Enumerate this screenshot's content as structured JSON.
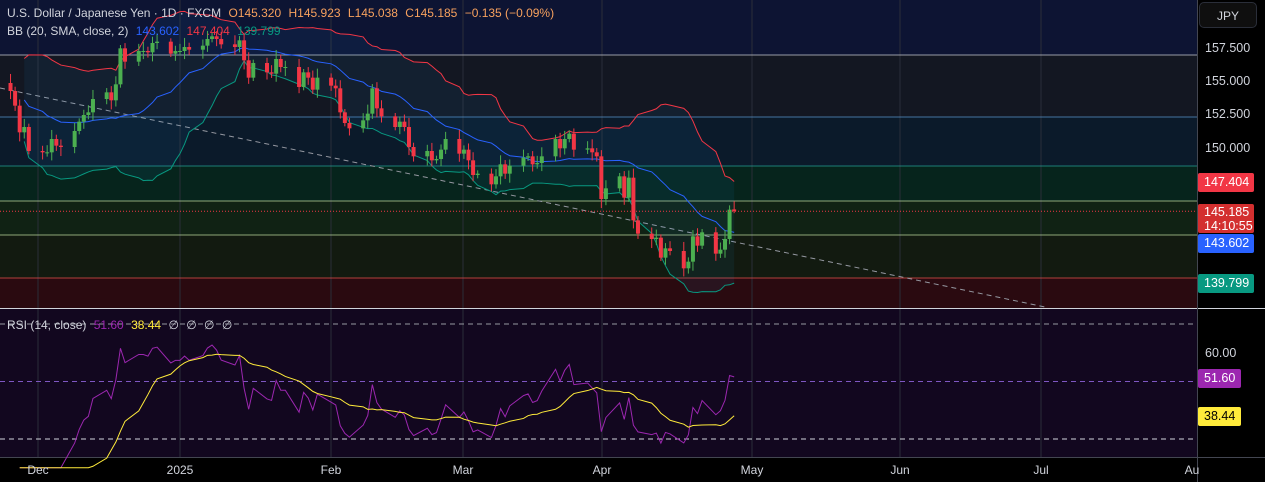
{
  "header": {
    "symbol": "U.S. Dollar / Japanese Yen · 1D · FXCM",
    "open": "O145.320",
    "high": "H145.923",
    "low": "L145.038",
    "close": "C145.185",
    "change": "−0.135 (−0.09%)"
  },
  "bb_legend": {
    "label": "BB (20, SMA, close, 2)",
    "basis": "143.602",
    "upper": "147.404",
    "lower": "139.799"
  },
  "rsi_legend": {
    "label": "RSI (14, close)",
    "rsi": "51.60",
    "ma": "38.44",
    "extra": [
      "∅",
      "∅",
      "∅",
      "∅"
    ]
  },
  "currency_button": "JPY",
  "price_axis": [
    "157.500",
    "155.000",
    "152.500",
    "150.000"
  ],
  "rsi_axis": [
    "60.00"
  ],
  "tags": {
    "upper": "147.404",
    "last": "145.185",
    "countdown": "14:10:55",
    "basis": "143.602",
    "lower": "139.799",
    "rsi": "51.60",
    "rsi_ma": "38.44"
  },
  "time_axis": [
    "Dec",
    "2025",
    "Feb",
    "Mar",
    "Apr",
    "May",
    "Jun",
    "Jul",
    "Au"
  ],
  "colors": {
    "up": "#4caf50",
    "down": "#f23645",
    "bb_basis": "#2962ff",
    "bb_upper": "#f23645",
    "bb_lower": "#089981",
    "rsi": "#9c27b0",
    "rsi_ma": "#ffeb3b"
  },
  "chart_data": {
    "type": "candlestick",
    "title": "U.S. Dollar / Japanese Yen · 1D · FXCM",
    "start_date": "2024-11-20",
    "closes": [
      155.4,
      154.6,
      154.8,
      154.2,
      153.1,
      151.1,
      151.5,
      149.7,
      149.6,
      149.6,
      150.6,
      150.1,
      150.0,
      151.2,
      151.9,
      152.4,
      152.6,
      153.6,
      154.1,
      153.5,
      154.7,
      157.4,
      156.4,
      157.2,
      157.2,
      157.1,
      157.8,
      157.9,
      157.0,
      157.2,
      157.2,
      157.5,
      157.3,
      157.6,
      158.1,
      158.3,
      158.1,
      157.7,
      157.5,
      158.0,
      156.5,
      155.2,
      156.3,
      155.6,
      155.5,
      156.6,
      156.0,
      156.0,
      154.5,
      155.6,
      155.2,
      154.3,
      155.2,
      154.6,
      154.4,
      152.6,
      151.8,
      151.4,
      152.0,
      152.5,
      154.4,
      152.9,
      152.3,
      151.5,
      151.9,
      151.5,
      150.0,
      149.3,
      149.7,
      149.0,
      149.1,
      149.8,
      150.6,
      149.5,
      149.8,
      149.0,
      147.9,
      148.0,
      147.2,
      147.8,
      148.7,
      148.0,
      148.6,
      149.2,
      149.3,
      148.7,
      148.8,
      149.3,
      150.6,
      149.9,
      150.6,
      151.0,
      149.8,
      149.9,
      149.6,
      149.3,
      146.1,
      146.9,
      147.8,
      146.2,
      147.7,
      144.5,
      143.5,
      143.1,
      143.2,
      141.7,
      142.4,
      142.2,
      140.9,
      141.4,
      143.3,
      142.6,
      143.6,
      142.0,
      142.3,
      143.1,
      145.3,
      145.185
    ],
    "last": {
      "open": 145.32,
      "high": 145.923,
      "low": 145.038,
      "close": 145.185
    },
    "indicators": {
      "bb": {
        "length": 20,
        "mult": 2,
        "basis": 143.602,
        "upper": 147.404,
        "lower": 139.799
      },
      "rsi": {
        "length": 14,
        "value": 51.6,
        "ma": 38.44,
        "levels": [
          70,
          50,
          30
        ]
      }
    },
    "ylim": [
      137.5,
      161
    ],
    "horizontal_levels": [
      157.0,
      152.35,
      148.7,
      146.0,
      143.5,
      140.3
    ]
  }
}
